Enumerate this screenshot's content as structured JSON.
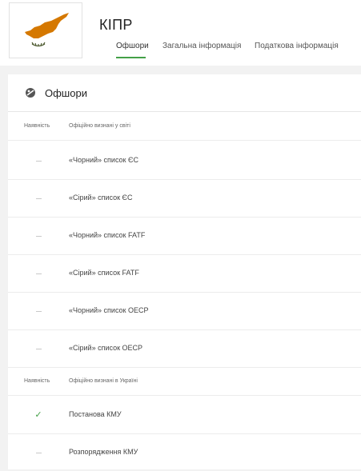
{
  "header": {
    "country": "КІПР",
    "tabs": [
      {
        "label": "Офшори",
        "active": true
      },
      {
        "label": "Загальна інформація",
        "active": false
      },
      {
        "label": "Податкова інформація",
        "active": false
      }
    ],
    "flag": {
      "icon": "cyprus-flag",
      "map_color": "#d57800",
      "branch_color": "#4e5b31"
    }
  },
  "card": {
    "title": "Офшори",
    "icon": "offshore-icon",
    "sections": [
      {
        "col_status": "Наявність",
        "col_name": "Офіційно визнані у світі",
        "rows": [
          {
            "status": "none",
            "label": "«Чорний» список ЄС"
          },
          {
            "status": "none",
            "label": "«Сірий» список ЄС"
          },
          {
            "status": "none",
            "label": "«Чорний» список FATF"
          },
          {
            "status": "none",
            "label": "«Сірий» список FATF"
          },
          {
            "status": "none",
            "label": "«Чорний» список OECP"
          },
          {
            "status": "none",
            "label": "«Сірий» список OECP"
          }
        ]
      },
      {
        "col_status": "Наявність",
        "col_name": "Офіційно визнані в Україні",
        "rows": [
          {
            "status": "yes",
            "label": "Постанова КМУ"
          },
          {
            "status": "none",
            "label": "Розпорядження КМУ"
          }
        ]
      }
    ]
  },
  "colors": {
    "accent": "#43a047",
    "check": "#43a047",
    "dash": "#c8c8c8"
  }
}
